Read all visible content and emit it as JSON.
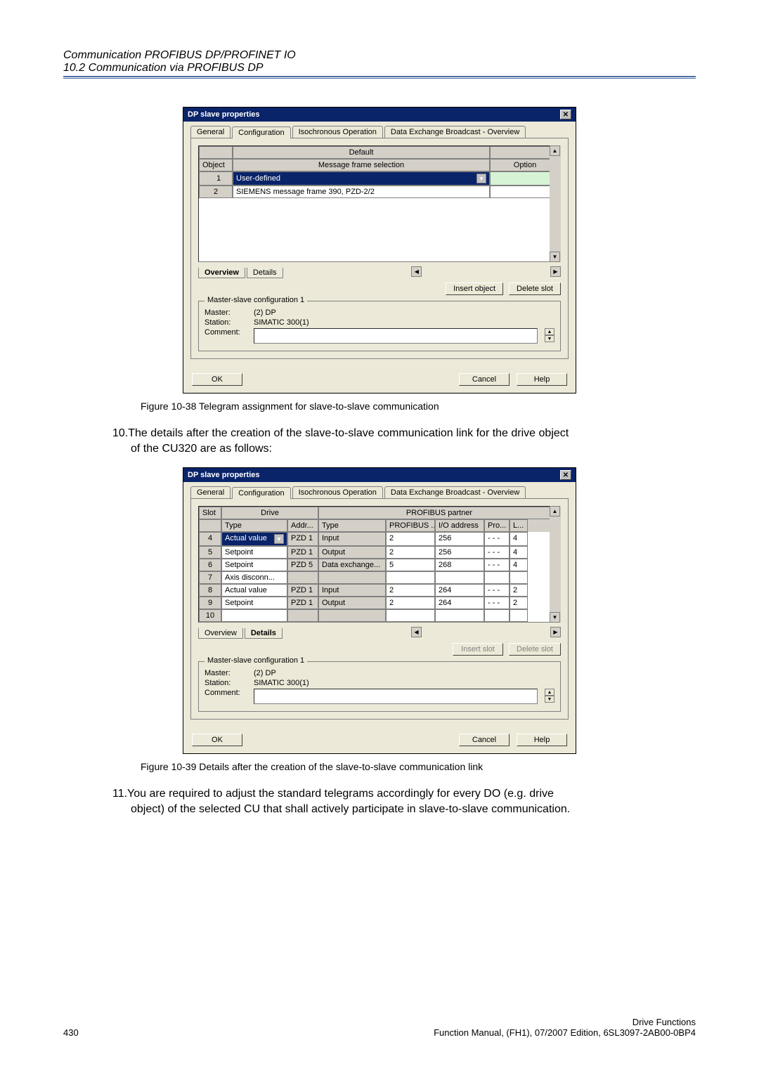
{
  "header": {
    "line1": "Communication PROFIBUS DP/PROFINET IO",
    "line2": "10.2 Communication via PROFIBUS DP"
  },
  "dialog1": {
    "title": "DP slave properties",
    "tabs": [
      "General",
      "Configuration",
      "Isochronous Operation",
      "Data Exchange Broadcast - Overview"
    ],
    "default_label": "Default",
    "col_object": "Object",
    "col_msg": "Message frame selection",
    "col_option": "Option",
    "rows": [
      {
        "obj": "1",
        "msg": "User-defined",
        "opt": ""
      },
      {
        "obj": "2",
        "msg": "SIEMENS message frame 390, PZD-2/2",
        "opt": ""
      }
    ],
    "inner_tabs": {
      "overview": "Overview",
      "details": "Details"
    },
    "insert_object": "Insert object",
    "delete_slot": "Delete slot",
    "group_title": "Master-slave configuration 1",
    "master_label": "Master:",
    "master_value": "(2) DP",
    "station_label": "Station:",
    "station_value": "SIMATIC 300(1)",
    "comment_label": "Comment:",
    "ok": "OK",
    "cancel": "Cancel",
    "help": "Help"
  },
  "caption1": "Figure 10-38   Telegram assignment for slave-to-slave communication",
  "para1_a": "10.The details after the creation of the slave-to-slave communication link for the drive object",
  "para1_b": "of the CU320 are as follows:",
  "dialog2": {
    "title": "DP slave properties",
    "tabs": [
      "General",
      "Configuration",
      "Isochronous Operation",
      "Data Exchange Broadcast - Overview"
    ],
    "col_slot": "Slot",
    "col_drive": "Drive",
    "col_pp": "PROFIBUS partner",
    "col_type": "Type",
    "col_addr": "Addr...",
    "col_type2": "Type",
    "col_profibus": "PROFIBUS ...",
    "col_io": "I/O address",
    "col_pro": "Pro...",
    "col_l": "L...",
    "rows": [
      {
        "slot": "4",
        "type": "Actual value",
        "addr": "PZD 1",
        "type2": "Input",
        "pb": "2",
        "io": "256",
        "pro": "- - -",
        "l": "4",
        "sel": true
      },
      {
        "slot": "5",
        "type": "Setpoint",
        "addr": "PZD 1",
        "type2": "Output",
        "pb": "2",
        "io": "256",
        "pro": "- - -",
        "l": "4"
      },
      {
        "slot": "6",
        "type": "Setpoint",
        "addr": "PZD 5",
        "type2": "Data exchange...",
        "pb": "5",
        "io": "268",
        "pro": "- - -",
        "l": "4"
      },
      {
        "slot": "7",
        "type": "Axis disconn...",
        "addr": "",
        "type2": "",
        "pb": "",
        "io": "",
        "pro": "",
        "l": ""
      },
      {
        "slot": "8",
        "type": "Actual value",
        "addr": "PZD 1",
        "type2": "Input",
        "pb": "2",
        "io": "264",
        "pro": "- - -",
        "l": "2"
      },
      {
        "slot": "9",
        "type": "Setpoint",
        "addr": "PZD 1",
        "type2": "Output",
        "pb": "2",
        "io": "264",
        "pro": "- - -",
        "l": "2"
      },
      {
        "slot": "10",
        "type": "",
        "addr": "",
        "type2": "",
        "pb": "",
        "io": "",
        "pro": "",
        "l": ""
      }
    ],
    "inner_tabs": {
      "overview": "Overview",
      "details": "Details"
    },
    "insert_slot": "Insert slot",
    "delete_slot": "Delete slot",
    "group_title": "Master-slave configuration 1",
    "master_label": "Master:",
    "master_value": "(2) DP",
    "station_label": "Station:",
    "station_value": "SIMATIC 300(1)",
    "comment_label": "Comment:",
    "ok": "OK",
    "cancel": "Cancel",
    "help": "Help"
  },
  "caption2": "Figure 10-39   Details after the creation of the slave-to-slave communication link",
  "para2_a": "11.You are required to adjust the standard telegrams accordingly for every DO (e.g. drive",
  "para2_b": "object) of the selected CU that shall actively participate in slave-to-slave communication.",
  "footer": {
    "page": "430",
    "r1": "Drive Functions",
    "r2": "Function Manual, (FH1), 07/2007 Edition, 6SL3097-2AB00-0BP4"
  }
}
